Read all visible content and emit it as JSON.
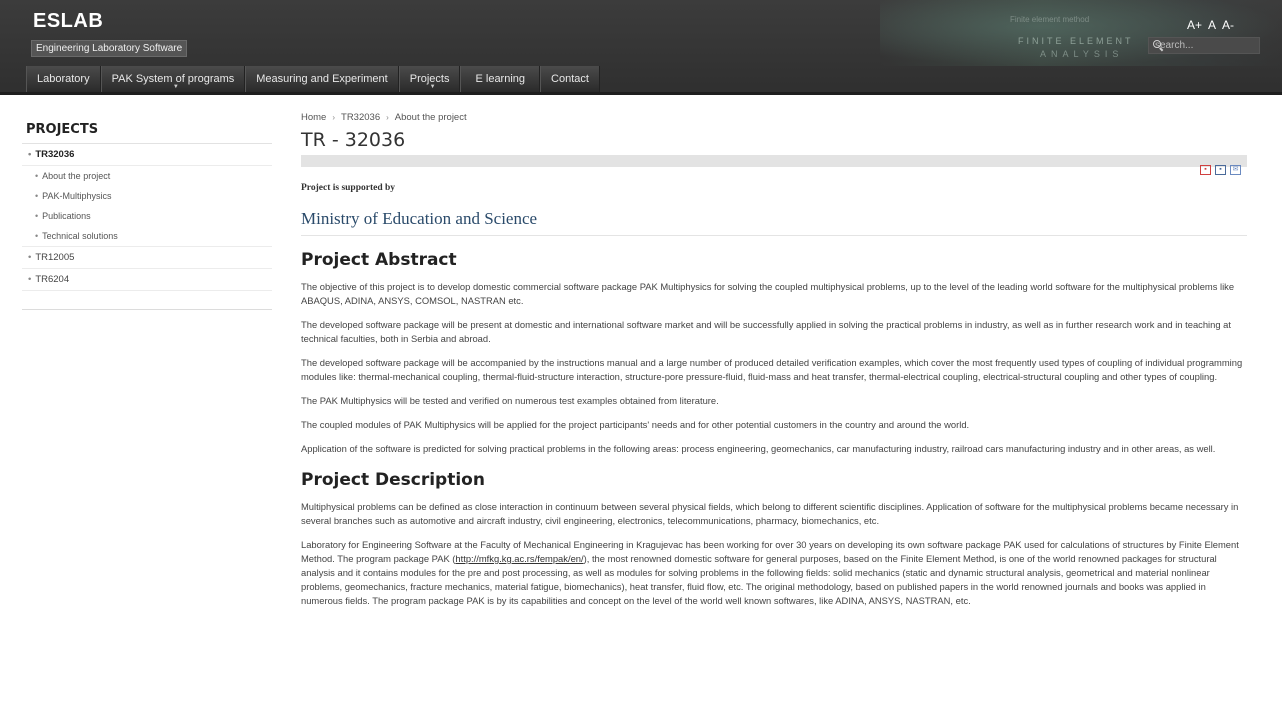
{
  "header": {
    "title": "ESLAB",
    "subtitle": "Engineering Laboratory Software",
    "banner_tag": "Finite element method",
    "banner_title": "FINITE ELEMENT",
    "banner_sub": "ANALYSIS",
    "font_controls": [
      "A+",
      "A",
      "A-"
    ],
    "search_placeholder": "search..."
  },
  "nav": {
    "items": [
      {
        "label": "Laboratory",
        "has_dropdown": false
      },
      {
        "label": "PAK System of programs",
        "has_dropdown": true
      },
      {
        "label": "Measuring and Experiment",
        "has_dropdown": false
      },
      {
        "label": "Projects",
        "has_dropdown": true
      },
      {
        "label": "E learning",
        "has_dropdown": false
      },
      {
        "label": "Contact",
        "has_dropdown": false
      }
    ]
  },
  "sidebar": {
    "title": "PROJECTS",
    "items": [
      {
        "label": "TR32036",
        "level": 0,
        "active": true
      },
      {
        "label": "About the project",
        "level": 1
      },
      {
        "label": "PAK-Multiphysics",
        "level": 1
      },
      {
        "label": "Publications",
        "level": 1
      },
      {
        "label": "Technical solutions",
        "level": 1
      },
      {
        "label": "TR12005",
        "level": 0
      },
      {
        "label": "TR6204",
        "level": 0
      }
    ]
  },
  "main": {
    "breadcrumb": [
      "Home",
      "TR32036",
      "About the project"
    ],
    "title": "TR - 32036",
    "supported_by": "Project is supported by",
    "ministry": "Ministry of Education and Science",
    "abstract_heading": "Project Abstract",
    "abstract_paragraphs": [
      "The objective of this project is to develop domestic commercial software package PAK Multiphysics for solving the coupled multiphysical problems, up to the level of the leading world software for the multiphysical problems like ABAQUS, ADINA, ANSYS, COMSOL, NASTRAN etc.",
      "The developed software package will be present at domestic and international software market and will be successfully applied in solving the practical problems in industry, as well as in further research work and in teaching at technical faculties, both in Serbia and abroad.",
      "The developed software package will be accompanied by the instructions manual and a large number of produced detailed verification examples, which cover the most frequently used types of coupling of individual programming modules like: thermal-mechanical coupling, thermal-fluid-structure interaction, structure-pore pressure-fluid, fluid-mass and heat transfer, thermal-electrical coupling, electrical-structural coupling and other types of coupling.",
      "The PAK Multiphysics will be tested and verified on numerous test examples obtained from literature.",
      "The coupled modules of PAK Multiphysics will be applied for the project participants' needs and for other potential customers in the country and around the world.",
      "Application of the software is predicted for solving practical problems in the following areas: process engineering, geomechanics, car manufacturing industry, railroad cars manufacturing industry and in other areas, as well."
    ],
    "description_heading": "Project Description",
    "description_p1": "Multiphysical problems can be defined as close interaction in continuum between several physical fields, which belong to different scientific disciplines. Application of software for the multiphysical problems became necessary in several branches such as automotive and aircraft industry, civil engineering, electronics, telecommunications, pharmacy, biomechanics, etc.",
    "description_p2_before": "Laboratory for Engineering Software at the Faculty of Mechanical Engineering in Kragujevac has been working for over 30 years on developing its own software package PAK used for calculations of structures by Finite Element Method. The program package PAK (",
    "description_p2_link": "http://mfkg.kg.ac.rs/fempak/en/",
    "description_p2_after": "), the most renowned domestic software for general purposes, based on the Finite Element Method, is one of the world renowned packages for structural analysis and it contains modules for the pre and post processing, as well as modules for solving problems in the following fields: solid mechanics (static and dynamic structural analysis, geometrical and material nonlinear problems, geomechanics, fracture mechanics, material fatigue, biomechanics), heat transfer, fluid flow, etc. The original methodology, based on published papers in the world renowned journals and books was applied in numerous fields. The program package PAK is by its capabilities and concept on the level of the world well known softwares, like ADINA, ANSYS, NASTRAN, etc."
  }
}
